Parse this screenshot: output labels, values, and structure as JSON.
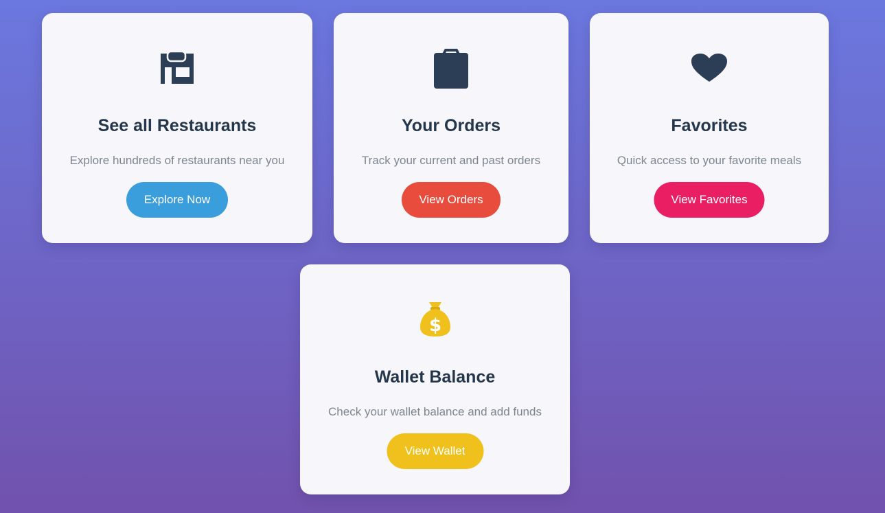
{
  "cards": [
    {
      "icon": "store-icon",
      "title": "See all Restaurants",
      "description": "Explore hundreds of restaurants near you",
      "button_label": "Explore Now",
      "button_color": "#3a9ddc"
    },
    {
      "icon": "shopping-bag-icon",
      "title": "Your Orders",
      "description": "Track your current and past orders",
      "button_label": "View Orders",
      "button_color": "#e84c3d"
    },
    {
      "icon": "heart-icon",
      "title": "Favorites",
      "description": "Quick access to your favorite meals",
      "button_label": "View Favorites",
      "button_color": "#ea1e63"
    },
    {
      "icon": "money-bag-icon",
      "title": "Wallet Balance",
      "description": "Check your wallet balance and add funds",
      "button_label": "View Wallet",
      "button_color": "#f0c11c"
    }
  ],
  "colors": {
    "background_top": "#6b78df",
    "background_bottom": "#7152ad",
    "card_background": "#f7f6fa",
    "title_text": "#25374d",
    "description_text": "#7c8690",
    "icon_dark": "#2c3e55",
    "wallet_icon": "#f0c11c"
  }
}
